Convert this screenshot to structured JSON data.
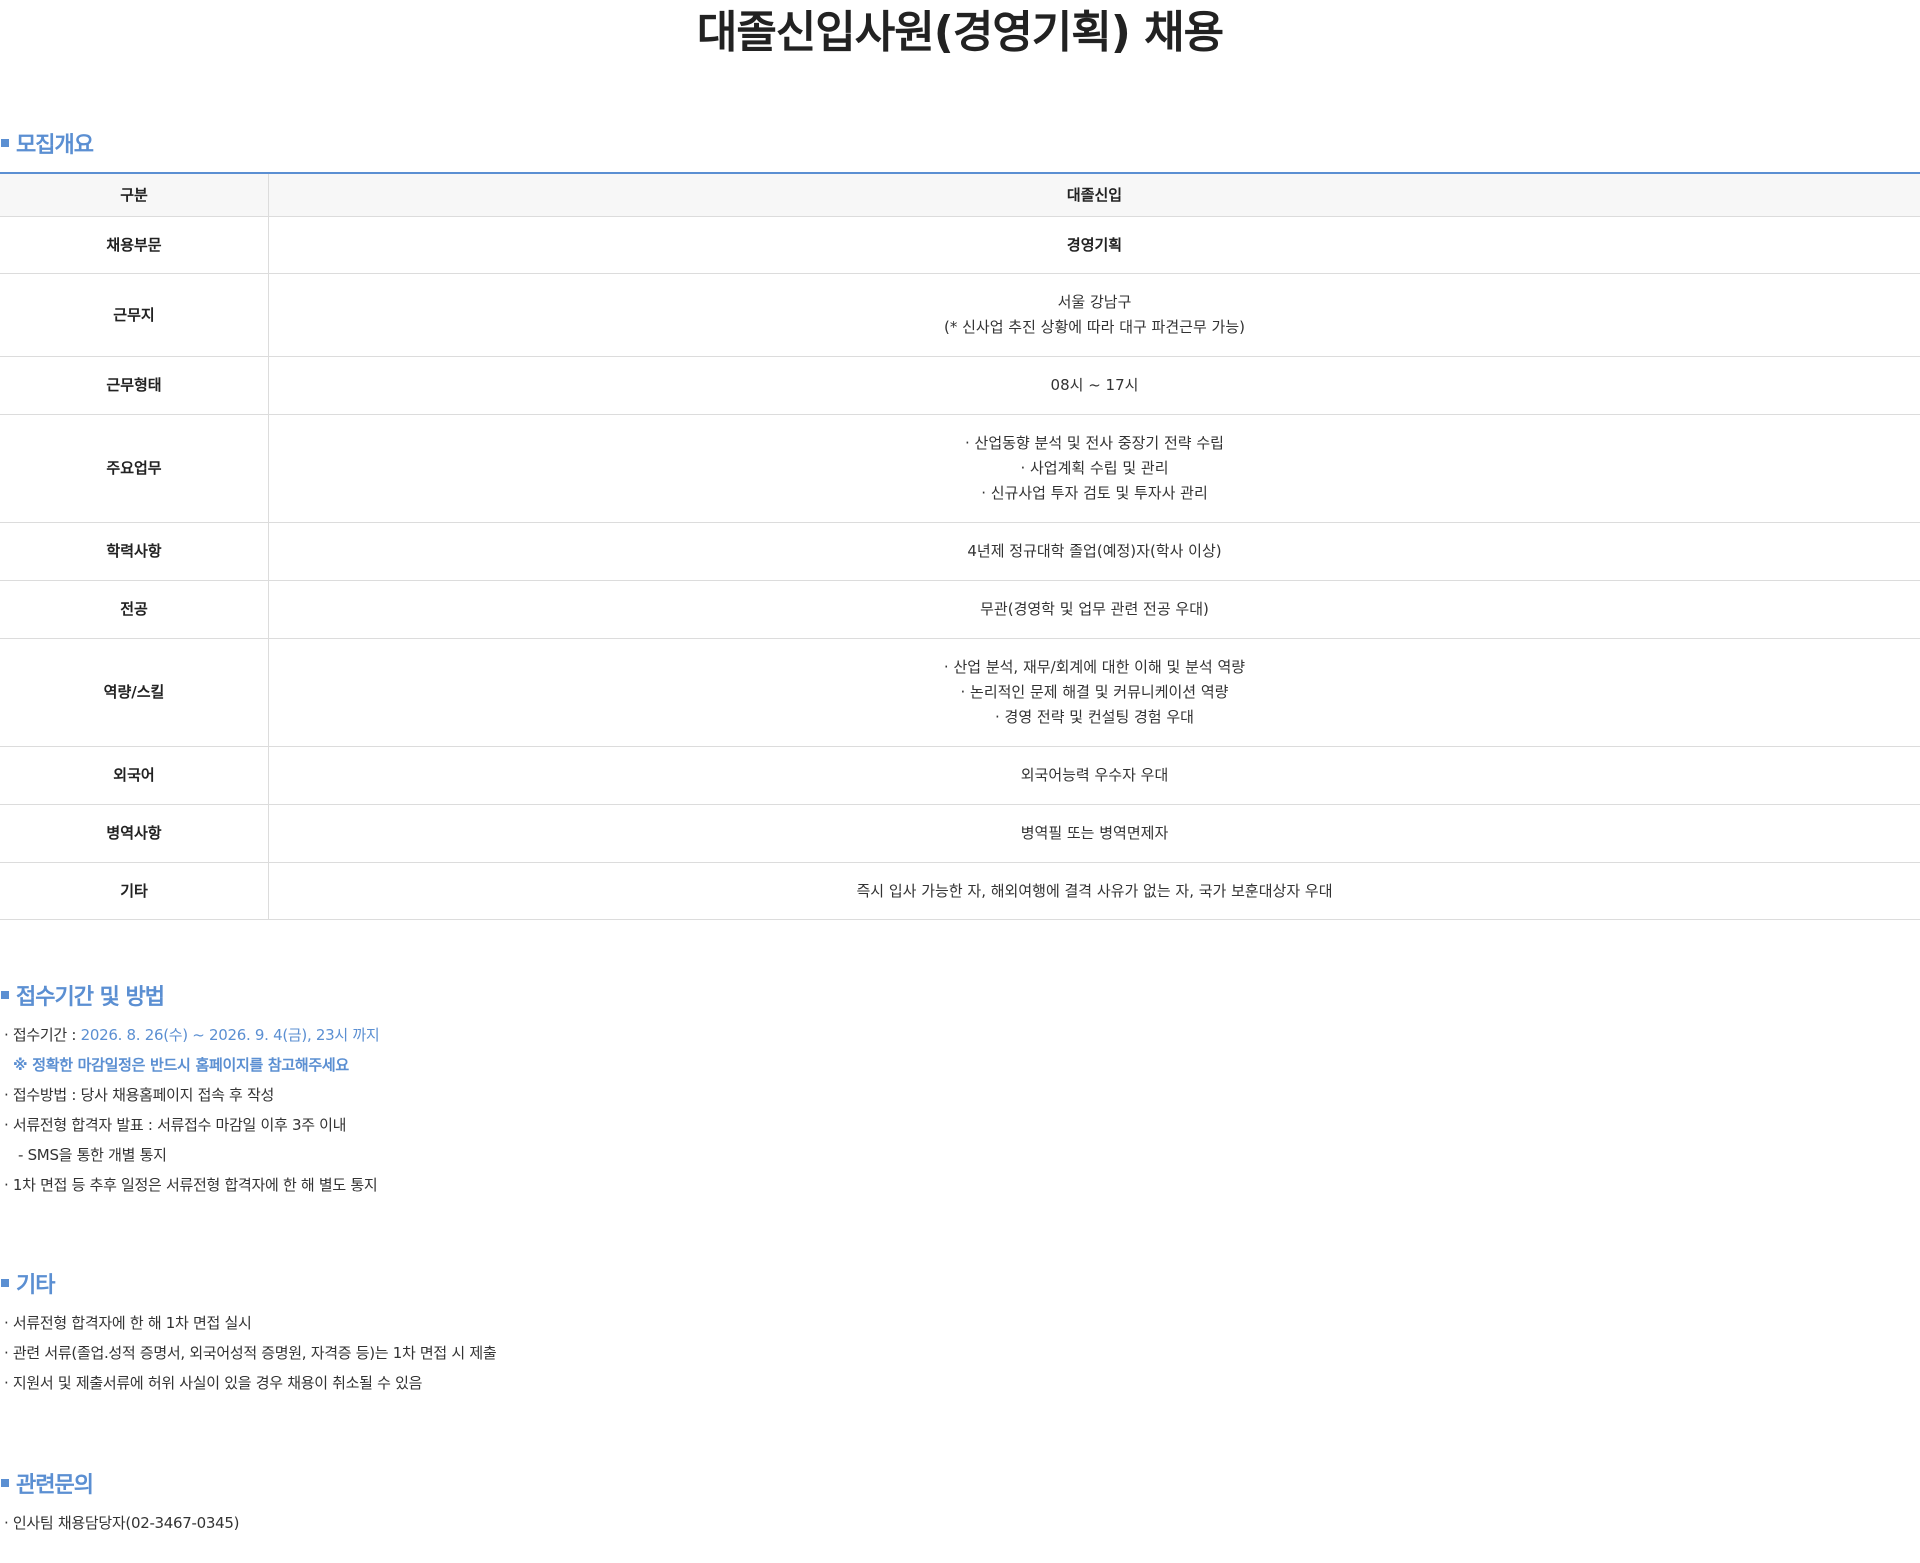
{
  "page": {
    "title": "대졸신입사원(경영기획) 채용"
  },
  "overview": {
    "heading": "모집개요",
    "header": {
      "label": "구분",
      "value": "대졸신입"
    },
    "rows": [
      {
        "label": "채용부문",
        "lines": [
          "경영기획"
        ]
      },
      {
        "label": "근무지",
        "lines": [
          "서울 강남구",
          "(* 신사업 추진 상황에 따라 대구 파견근무 가능)"
        ]
      },
      {
        "label": "근무형태",
        "lines": [
          "08시 ~ 17시"
        ]
      },
      {
        "label": "주요업무",
        "lines": [
          "· 산업동향 분석 및 전사 중장기 전략 수립",
          "· 사업계획 수립 및 관리",
          "· 신규사업 투자 검토 및 투자사 관리"
        ]
      },
      {
        "label": "학력사항",
        "lines": [
          "4년제 정규대학 졸업(예정)자(학사 이상)"
        ]
      },
      {
        "label": "전공",
        "lines": [
          "무관(경영학 및 업무 관련 전공 우대)"
        ]
      },
      {
        "label": "역량/스킬",
        "lines": [
          "· 산업 분석, 재무/회계에 대한 이해 및 분석 역량",
          "· 논리적인 문제 해결 및 커뮤니케이션 역량",
          "· 경영 전략 및 컨설팅 경험 우대"
        ]
      },
      {
        "label": "외국어",
        "lines": [
          "외국어능력 우수자 우대"
        ]
      },
      {
        "label": "병역사항",
        "lines": [
          "병역필 또는 병역면제자"
        ]
      },
      {
        "label": "기타",
        "lines": [
          "즉시 입사 가능한 자, 해외여행에 결격 사유가 없는 자, 국가 보훈대상자 우대"
        ]
      }
    ]
  },
  "apply": {
    "heading": "접수기간 및 방법",
    "period_label": "· 접수기간 : ",
    "period_value": "2026. 8. 26(수) ~ 2026. 9. 4(금), 23시 까지",
    "deadline_note": "※ 정확한 마감일정은 반드시 홈페이지를 참고해주세요",
    "method": "· 접수방법 : 당사 채용홈페이지 접속 후 작성",
    "announce": "· 서류전형 합격자 발표 : 서류접수 마감일 이후 3주 이내",
    "announce_sub": "- SMS을 통한 개별 통지",
    "interview": "· 1차 면접 등 추후 일정은 서류전형 합격자에 한 해 별도 통지"
  },
  "other": {
    "heading": "기타",
    "items": [
      "· 서류전형 합격자에 한 해 1차 면접 실시",
      "· 관련 서류(졸업.성적 증명서, 외국어성적 증명원, 자격증 등)는 1차 면접 시 제출",
      "· 지원서 및 제출서류에 허위 사실이 있을 경우 채용이 취소될 수 있음"
    ]
  },
  "contact": {
    "heading": "관련문의",
    "items": [
      "· 인사팀 채용담당자(02-3467-0345)"
    ]
  }
}
